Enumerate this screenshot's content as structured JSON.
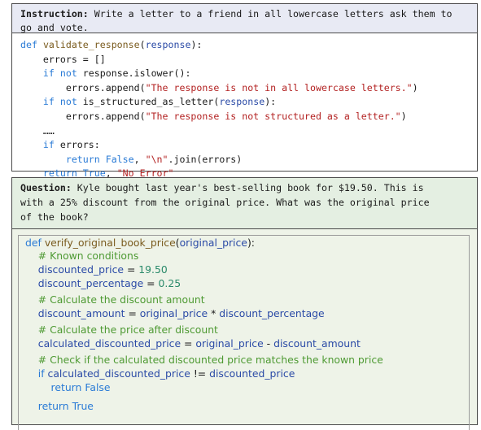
{
  "block1": {
    "header_label": "Instruction:",
    "header_text": " Write a letter to a friend in all lowercase letters ask them to go and vote.",
    "lines": [
      [
        {
          "t": "def",
          "c": "kw"
        },
        {
          "t": " "
        },
        {
          "t": "validate_response",
          "c": "fn"
        },
        {
          "t": "("
        },
        {
          "t": "response",
          "c": "var"
        },
        {
          "t": "):"
        }
      ],
      [
        {
          "t": "    errors = []"
        }
      ],
      [
        {
          "t": "    "
        },
        {
          "t": "if",
          "c": "kw"
        },
        {
          "t": " "
        },
        {
          "t": "not",
          "c": "kw"
        },
        {
          "t": " response.islower():"
        }
      ],
      [
        {
          "t": "        errors.append("
        },
        {
          "t": "\"The response is not in all lowercase letters.\"",
          "c": "str"
        },
        {
          "t": ")"
        }
      ],
      [
        {
          "t": "    "
        },
        {
          "t": "if",
          "c": "kw"
        },
        {
          "t": " "
        },
        {
          "t": "not",
          "c": "kw"
        },
        {
          "t": " is_structured_as_letter("
        },
        {
          "t": "response",
          "c": "var"
        },
        {
          "t": "):"
        }
      ],
      [
        {
          "t": "        errors.append("
        },
        {
          "t": "\"The response is not structured as a letter.\"",
          "c": "str"
        },
        {
          "t": ")"
        }
      ],
      [
        {
          "t": "    ……"
        }
      ],
      [
        {
          "t": "    "
        },
        {
          "t": "if",
          "c": "kw"
        },
        {
          "t": " errors:"
        }
      ],
      [
        {
          "t": "        "
        },
        {
          "t": "return",
          "c": "kw"
        },
        {
          "t": " "
        },
        {
          "t": "False",
          "c": "kw"
        },
        {
          "t": ", "
        },
        {
          "t": "\"",
          "c": "str"
        },
        {
          "t": "\\n",
          "c": "str"
        },
        {
          "t": "\"",
          "c": "str"
        },
        {
          "t": ".join(errors)"
        }
      ],
      [
        {
          "t": "    "
        },
        {
          "t": "return",
          "c": "kw"
        },
        {
          "t": " "
        },
        {
          "t": "True",
          "c": "kw"
        },
        {
          "t": ", "
        },
        {
          "t": "\"No Error\"",
          "c": "str"
        }
      ]
    ]
  },
  "block2": {
    "header_label": "Question:",
    "header_lines": [
      " Kyle bought last year's best-selling book for $19.50. This is",
      "with a 25% discount from the original price. What was the original price",
      "of the book?"
    ],
    "lines": [
      [
        {
          "t": "def",
          "c": "kw"
        },
        {
          "t": " "
        },
        {
          "t": "verify_original_book_price",
          "c": "fn"
        },
        {
          "t": "("
        },
        {
          "t": "original_price",
          "c": "var"
        },
        {
          "t": "):"
        }
      ],
      [
        {
          "t": "    "
        },
        {
          "t": "# Known conditions",
          "c": "com"
        }
      ],
      [
        {
          "t": "    "
        },
        {
          "t": "discounted_price",
          "c": "var"
        },
        {
          "t": " = "
        },
        {
          "t": "19.50",
          "c": "num"
        }
      ],
      [
        {
          "t": "    "
        },
        {
          "t": "discount_percentage",
          "c": "var"
        },
        {
          "t": " = "
        },
        {
          "t": "0.25",
          "c": "num"
        }
      ],
      [
        {
          "t": "    "
        },
        {
          "t": "# Calculate the discount amount",
          "c": "com"
        }
      ],
      [
        {
          "t": "    "
        },
        {
          "t": "discount_amount",
          "c": "var"
        },
        {
          "t": " = "
        },
        {
          "t": "original_price",
          "c": "var"
        },
        {
          "t": " * "
        },
        {
          "t": "discount_percentage",
          "c": "var"
        }
      ],
      [
        {
          "t": "    "
        },
        {
          "t": "# Calculate the price after discount",
          "c": "com"
        }
      ],
      [
        {
          "t": "    "
        },
        {
          "t": "calculated_discounted_price",
          "c": "var"
        },
        {
          "t": " = "
        },
        {
          "t": "original_price",
          "c": "var"
        },
        {
          "t": " - "
        },
        {
          "t": "discount_amount",
          "c": "var"
        }
      ],
      [
        {
          "t": "    "
        },
        {
          "t": "# Check if the calculated discounted price matches the known price",
          "c": "com"
        }
      ],
      [
        {
          "t": "    "
        },
        {
          "t": "if",
          "c": "kw"
        },
        {
          "t": " "
        },
        {
          "t": "calculated_discounted_price",
          "c": "var"
        },
        {
          "t": " != "
        },
        {
          "t": "discounted_price",
          "c": "var"
        }
      ],
      [
        {
          "t": "        "
        },
        {
          "t": "return",
          "c": "kw"
        },
        {
          "t": " "
        },
        {
          "t": "False",
          "c": "kw"
        }
      ],
      [
        {
          "t": "    "
        },
        {
          "t": "return",
          "c": "kw"
        },
        {
          "t": " "
        },
        {
          "t": "True",
          "c": "kw"
        }
      ]
    ]
  }
}
